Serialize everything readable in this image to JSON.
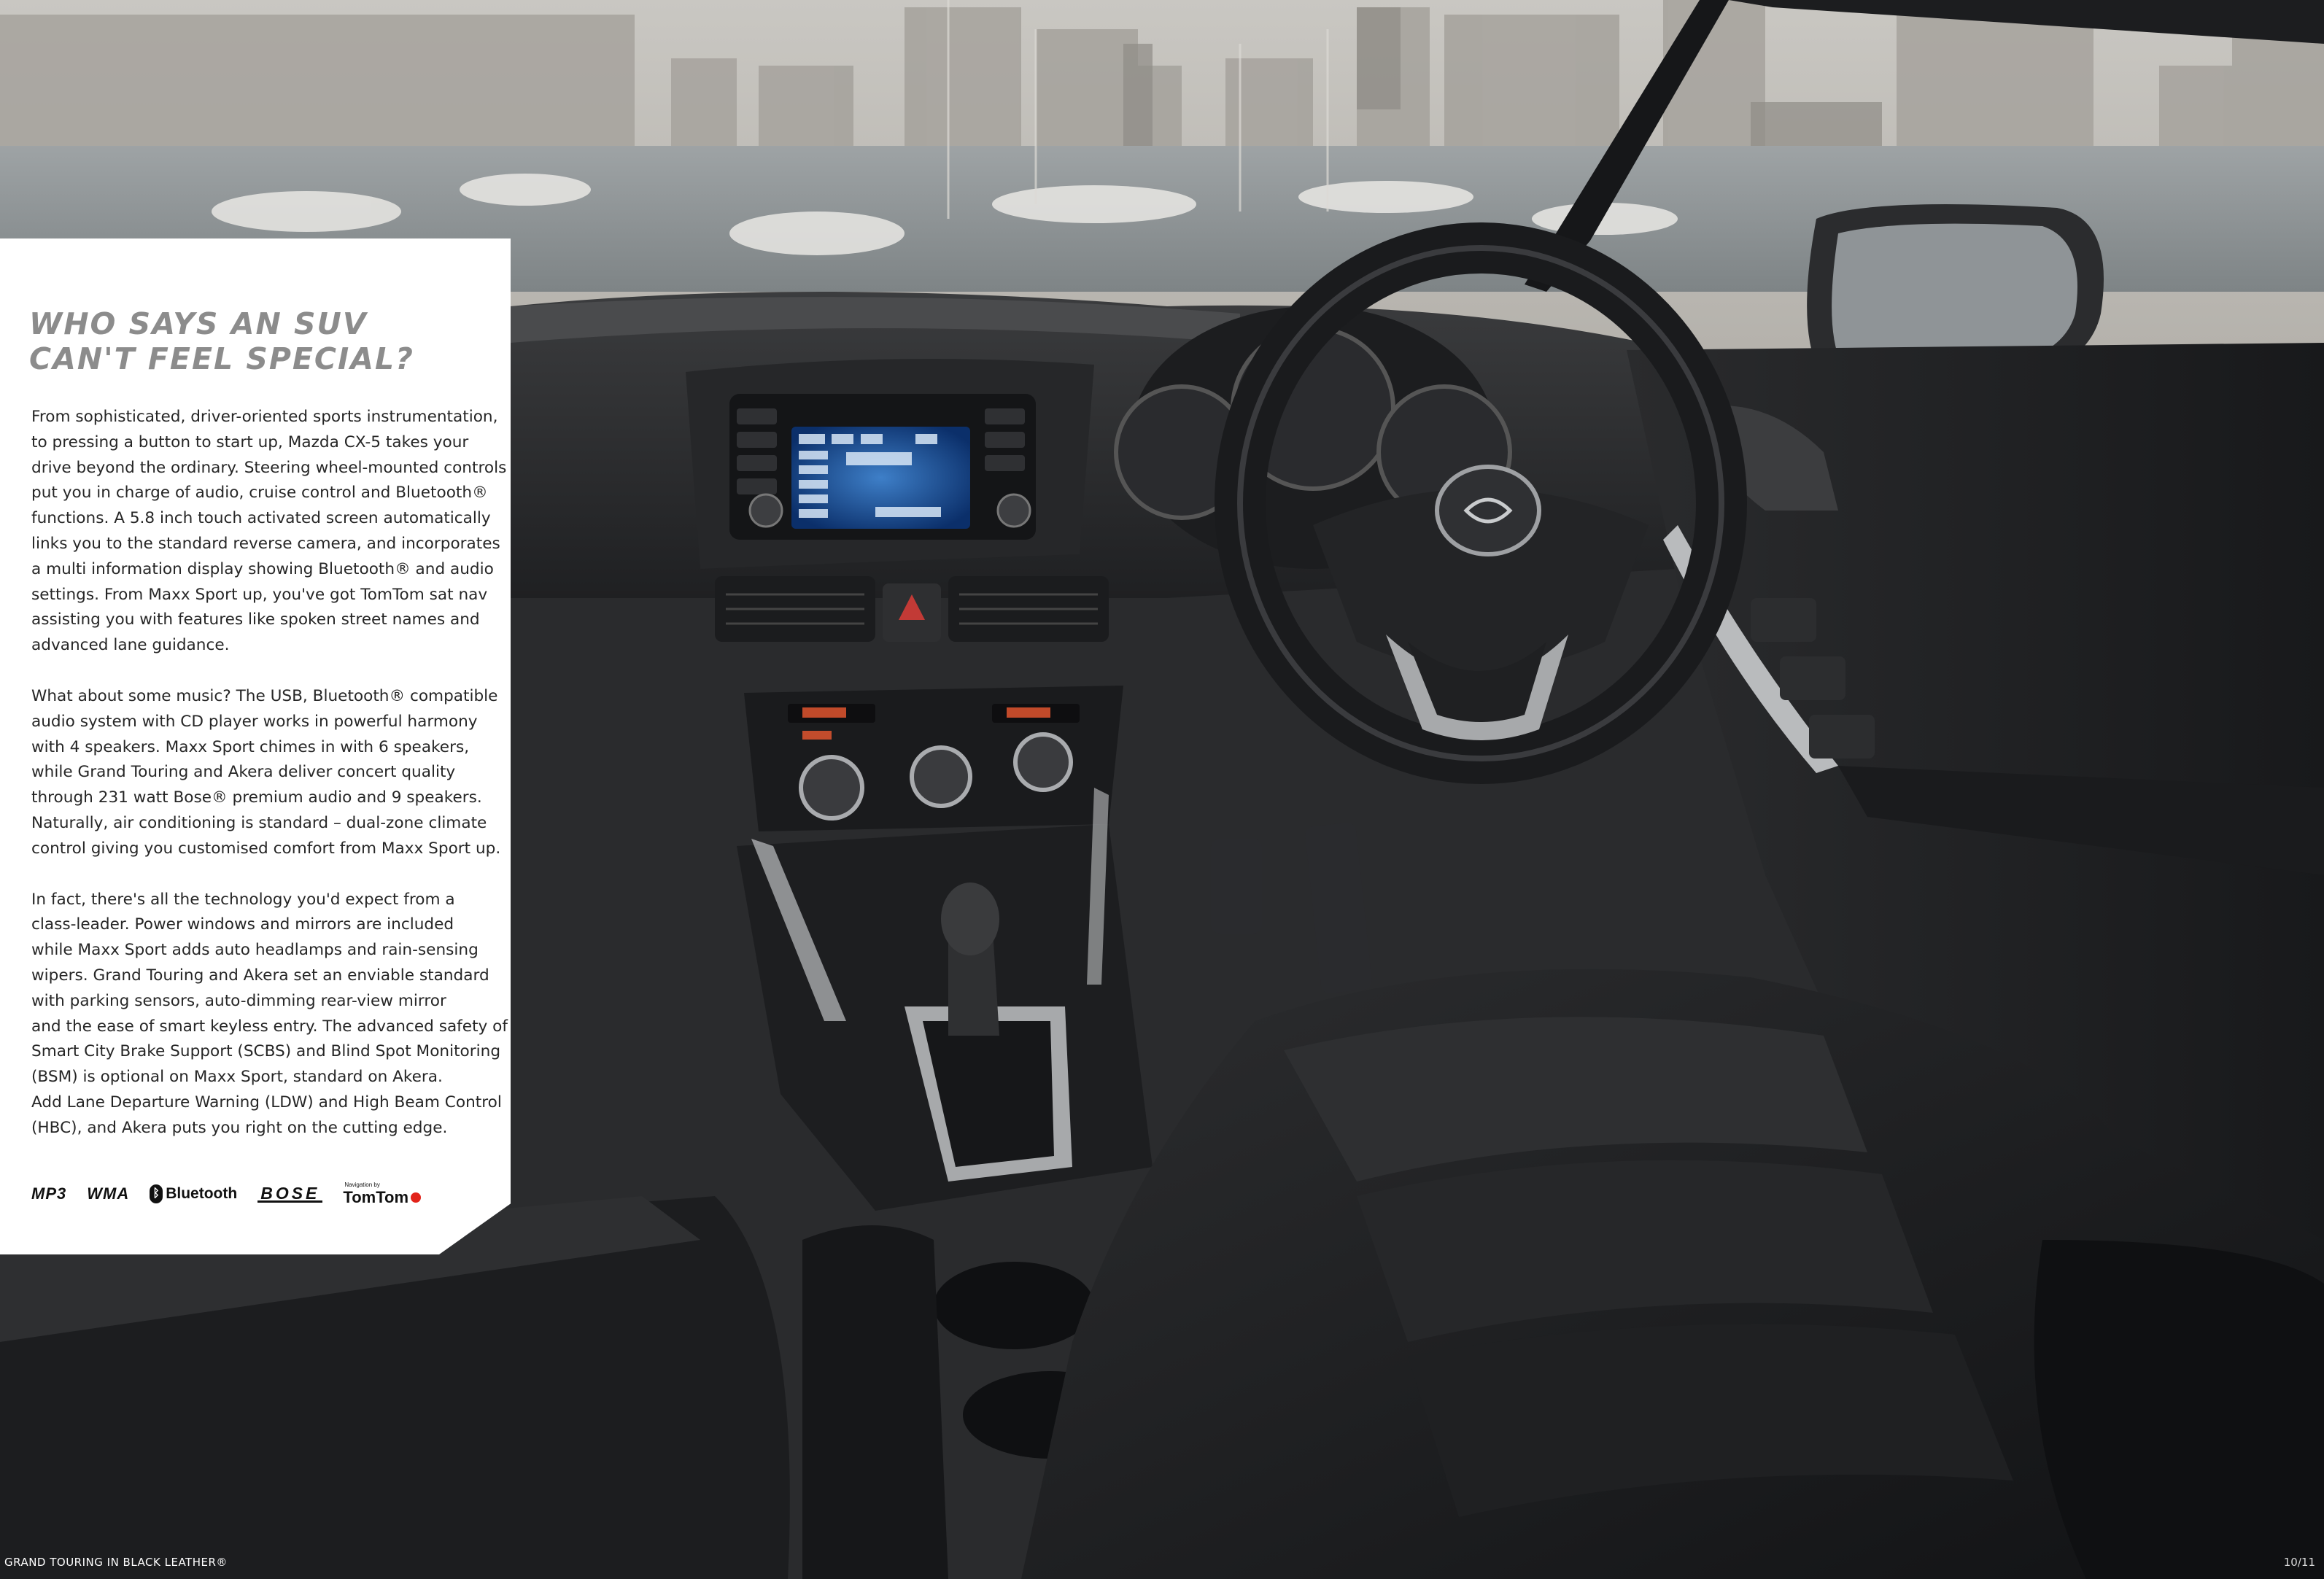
{
  "headline": [
    "WHO SAYS AN SUV",
    "CAN'T FEEL SPECIAL?"
  ],
  "paragraphs": [
    [
      "From sophisticated, driver-oriented sports instrumentation,",
      "to pressing a button to start up, Mazda CX-5 takes your",
      "drive beyond the ordinary. Steering wheel-mounted controls",
      "put you in charge of audio, cruise control and Bluetooth®",
      "functions. A 5.8 inch touch activated screen automatically",
      "links you to the standard reverse camera, and incorporates",
      "a multi information display showing Bluetooth® and audio",
      "settings. From Maxx Sport up, you've got TomTom sat nav",
      "assisting you with features like spoken street names and",
      "advanced lane guidance."
    ],
    [
      "What about some music? The USB, Bluetooth® compatible",
      "audio system with CD player works in powerful harmony",
      "with 4 speakers. Maxx Sport chimes in with 6 speakers,",
      "while Grand Touring and Akera deliver concert quality",
      "through 231 watt Bose® premium audio and 9 speakers.",
      "Naturally, air conditioning is standard – dual-zone climate",
      "control giving you customised comfort from Maxx Sport up."
    ],
    [
      "In fact, there's all the technology you'd expect from a",
      "class-leader. Power windows and mirrors are included",
      "while Maxx Sport adds auto headlamps and rain-sensing",
      "wipers. Grand Touring and Akera set an enviable standard",
      "with parking sensors, auto-dimming rear-view mirror",
      "and the ease of smart keyless entry. The advanced safety of",
      "Smart City Brake Support (SCBS) and Blind Spot Monitoring",
      "(BSM) is optional on Maxx Sport, standard on Akera.",
      "Add Lane Departure Warning (LDW) and High Beam Control",
      "(HBC), and Akera puts you right on the cutting edge."
    ]
  ],
  "logos": {
    "mp3": "MP3",
    "wma": "WMA",
    "bluetooth": "Bluetooth",
    "bluetooth_glyph": "ᛒ",
    "bose": "BOSE",
    "tomtom_small": "Navigation by",
    "tomtom": "TomTom"
  },
  "dashboard_screen": {
    "band": "FM",
    "frequency": "101.30 MHz",
    "tabs": [
      "FM",
      "AM",
      "CD",
      "USB",
      "AUX"
    ],
    "presets": [
      "100.10",
      "101.10",
      "101.30",
      "104.30",
      "105.10",
      "107.30"
    ]
  },
  "caption": "GRAND TOURING IN BLACK LEATHER®",
  "page_number": "10/11",
  "colors": {
    "headline": "#8c8c8c",
    "body_text": "#262626",
    "panel": "#ffffff",
    "interior": "#2a2b2d",
    "tomtom_accent": "#e2231a"
  }
}
